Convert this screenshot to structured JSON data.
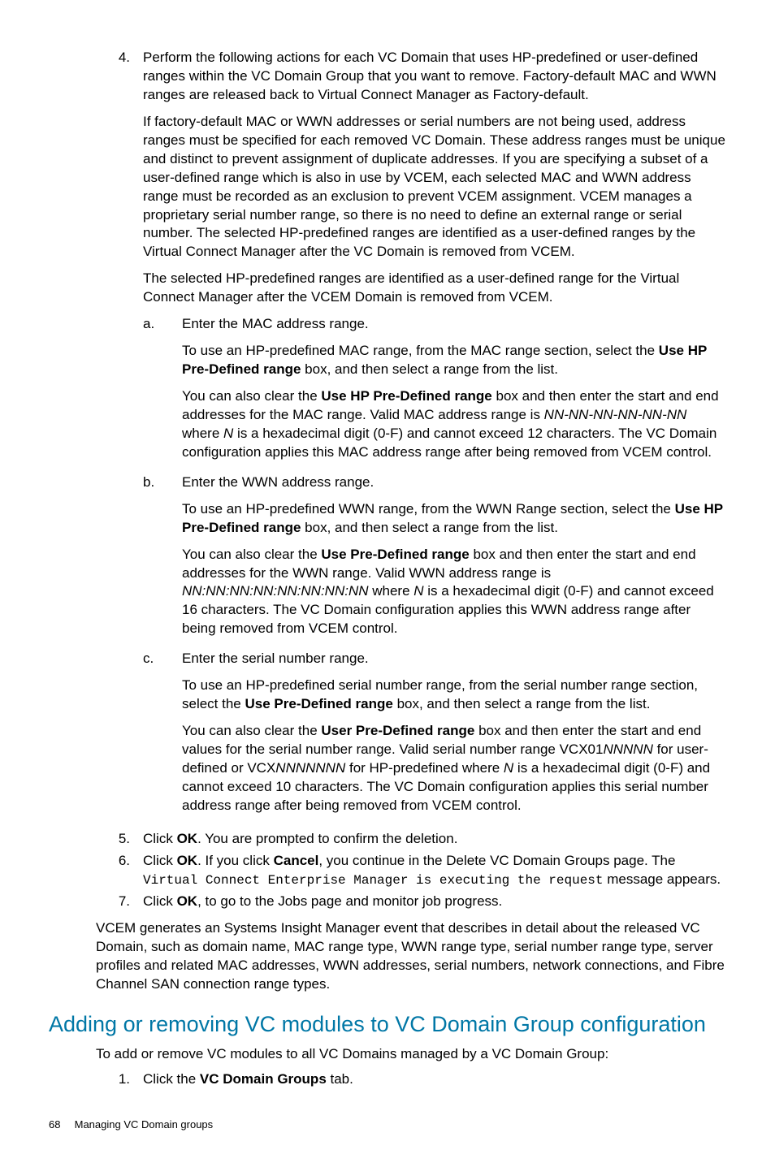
{
  "step4": {
    "num": "4.",
    "p1": "Perform the following actions for each VC Domain that uses HP-predefined or user-defined ranges within the VC Domain Group that you want to remove. Factory-default MAC and WWN ranges are released back to Virtual Connect Manager as Factory-default.",
    "p2": "If factory-default MAC or WWN addresses or serial numbers are not being used, address ranges must be specified for each removed VC Domain. These address ranges must be unique and distinct to prevent assignment of duplicate addresses. If you are specifying a subset of a user-defined range which is also in use by VCEM, each selected MAC and WWN address range must be recorded as an exclusion to prevent VCEM assignment. VCEM manages a proprietary serial number range, so there is no need to define an external range or serial number. The selected HP-predefined ranges are identified as a user-defined ranges by the Virtual Connect Manager after the VC Domain is removed from VCEM.",
    "p3": "The selected HP-predefined ranges are identified as a user-defined range for the Virtual Connect Manager after the VCEM Domain is removed from VCEM."
  },
  "subA": {
    "letter": "a.",
    "p1": "Enter the MAC address range.",
    "p2_a": "To use an HP-predefined MAC range, from the MAC range section, select the ",
    "p2_b": "Use HP Pre-Defined range",
    "p2_c": " box, and then select a range from the list.",
    "p3_a": "You can also clear the ",
    "p3_b": "Use HP Pre-Defined range",
    "p3_c": " box and then enter the start and end addresses for the MAC range. Valid MAC address range is ",
    "p3_d": "NN-NN-NN-NN-NN-NN",
    "p3_e": " where ",
    "p3_f": "N",
    "p3_g": " is a hexadecimal digit (0-F) and cannot exceed 12 characters. The VC Domain configuration applies this MAC address range after being removed from VCEM control."
  },
  "subB": {
    "letter": "b.",
    "p1": "Enter the WWN address range.",
    "p2_a": "To use an HP-predefined WWN range, from the WWN Range section, select the ",
    "p2_b": "Use HP Pre-Defined range",
    "p2_c": " box, and then select a range from the list.",
    "p3_a": "You can also clear the ",
    "p3_b": "Use Pre-Defined range",
    "p3_c": " box and then enter the start and end addresses for the WWN range. Valid WWN address range is ",
    "p3_d": "NN:NN:NN:NN:NN:NN:NN:NN",
    "p3_e": " where ",
    "p3_f": "N",
    "p3_g": " is a hexadecimal digit (0-F) and cannot exceed 16 characters. The VC Domain configuration applies this WWN address range after being removed from VCEM control."
  },
  "subC": {
    "letter": "c.",
    "p1": "Enter the serial number range.",
    "p2_a": "To use an HP-predefined serial number range, from the serial number range section, select the ",
    "p2_b": "Use Pre-Defined range",
    "p2_c": " box, and then select a range from the list.",
    "p3_a": "You can also clear the ",
    "p3_b": "User Pre-Defined range",
    "p3_c": " box and then enter the start and end values for the serial number range. Valid serial number range VCX01",
    "p3_d": "NNNNN",
    "p3_e": " for user-defined or VCX",
    "p3_f": "NNNNNNN",
    "p3_g": " for HP-predefined where ",
    "p3_h": "N",
    "p3_i": " is a hexadecimal digit (0-F) and cannot exceed 10 characters. The VC Domain configuration applies this serial number address range after being removed from VCEM control."
  },
  "step5": {
    "num": "5.",
    "a": "Click ",
    "b": "OK",
    "c": ". You are prompted to confirm the deletion."
  },
  "step6": {
    "num": "6.",
    "a": "Click ",
    "b": "OK",
    "c": ". If you click ",
    "d": "Cancel",
    "e": ", you continue in the Delete VC Domain Groups page. The ",
    "f": "Virtual Connect Enterprise Manager is executing the request",
    "g": " message appears."
  },
  "step7": {
    "num": "7.",
    "a": "Click ",
    "b": "OK",
    "c": ", to go to the Jobs page and monitor job progress."
  },
  "conclusion": "VCEM generates an Systems Insight Manager event that describes in detail about the released VC Domain, such as domain name, MAC range type, WWN range type, serial number range type, server profiles and related MAC addresses, WWN addresses, serial numbers, network connections, and Fibre Channel SAN connection range types.",
  "section_heading": "Adding or removing VC modules to VC Domain Group configuration",
  "section_intro": "To add or remove VC modules to all VC Domains managed by a VC Domain Group:",
  "sec_step1": {
    "num": "1.",
    "a": "Click the ",
    "b": "VC Domain Groups",
    "c": " tab."
  },
  "footer": {
    "page": "68",
    "title": "Managing VC Domain groups"
  }
}
